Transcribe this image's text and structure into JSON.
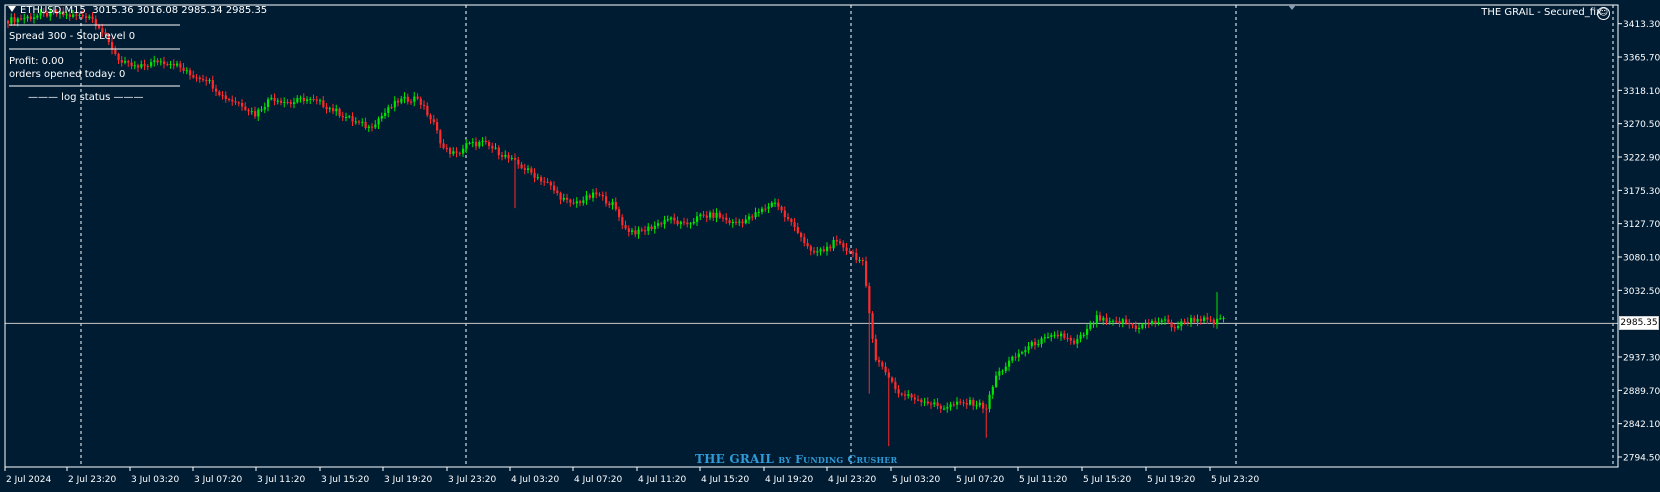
{
  "header": {
    "symbol": "ETHUSD,M15",
    "ohlc": "3015.36 3016.08 2985.34 2985.35"
  },
  "ea_panel": {
    "title": "THE GRAIL - Secured_fix",
    "spread_line": "Spread 300 - StopLevel 0",
    "profit_line": "Profit: 0.00",
    "orders_line": "orders opened today: 0",
    "log_line": "——— log status ———"
  },
  "watermark": {
    "main": "THE GRAIL",
    "by": "by Funding Crusher"
  },
  "colors": {
    "background": "#001c33",
    "bull": "#00e600",
    "bear": "#ff2a2a",
    "grid": "#ffffff",
    "text": "#ffffff",
    "watermark": "#2e9ad6"
  },
  "chart_data": {
    "type": "candlestick",
    "symbol": "ETHUSD",
    "timeframe": "M15",
    "current_price": "2985.35",
    "ylim": [
      2794.5,
      3440
    ],
    "y_ticks": [
      "3413.30",
      "3365.70",
      "3318.10",
      "3270.50",
      "3222.90",
      "3175.30",
      "3127.70",
      "3080.10",
      "3032.50",
      "2985.35",
      "2937.30",
      "2889.70",
      "2842.10",
      "2794.50"
    ],
    "x_ticks": [
      "2 Jul 2024",
      "2 Jul 23:20",
      "3 Jul 03:20",
      "3 Jul 07:20",
      "3 Jul 11:20",
      "3 Jul 15:20",
      "3 Jul 19:20",
      "3 Jul 23:20",
      "4 Jul 03:20",
      "4 Jul 07:20",
      "4 Jul 11:20",
      "4 Jul 15:20",
      "4 Jul 19:20",
      "4 Jul 23:20",
      "5 Jul 03:20",
      "5 Jul 07:20",
      "5 Jul 11:20",
      "5 Jul 15:20",
      "5 Jul 19:20",
      "5 Jul 23:20"
    ],
    "day_separators": [
      "2 Jul 23:20",
      "3 Jul 23:20",
      "4 Jul 23:20",
      "5 Jul 23:20"
    ],
    "close_anchors": [
      [
        0,
        3418
      ],
      [
        14,
        3428
      ],
      [
        20,
        3424
      ],
      [
        25,
        3425
      ],
      [
        28,
        3410
      ],
      [
        31,
        3385
      ],
      [
        35,
        3357
      ],
      [
        40,
        3350
      ],
      [
        46,
        3360
      ],
      [
        51,
        3357
      ],
      [
        56,
        3340
      ],
      [
        61,
        3335
      ],
      [
        66,
        3310
      ],
      [
        72,
        3298
      ],
      [
        76,
        3284
      ],
      [
        81,
        3308
      ],
      [
        87,
        3300
      ],
      [
        91,
        3306
      ],
      [
        96,
        3300
      ],
      [
        101,
        3288
      ],
      [
        106,
        3275
      ],
      [
        111,
        3265
      ],
      [
        115,
        3282
      ],
      [
        120,
        3303
      ],
      [
        126,
        3308
      ],
      [
        128,
        3292
      ],
      [
        131,
        3270
      ],
      [
        134,
        3235
      ],
      [
        138,
        3226
      ],
      [
        141,
        3240
      ],
      [
        146,
        3243
      ],
      [
        151,
        3230
      ],
      [
        156,
        3215
      ],
      [
        161,
        3200
      ],
      [
        166,
        3185
      ],
      [
        169,
        3170
      ],
      [
        173,
        3155
      ],
      [
        177,
        3162
      ],
      [
        181,
        3170
      ],
      [
        186,
        3155
      ],
      [
        190,
        3120
      ],
      [
        194,
        3115
      ],
      [
        199,
        3125
      ],
      [
        203,
        3135
      ],
      [
        208,
        3125
      ],
      [
        213,
        3138
      ],
      [
        218,
        3140
      ],
      [
        223,
        3128
      ],
      [
        228,
        3135
      ],
      [
        233,
        3150
      ],
      [
        236,
        3160
      ],
      [
        239,
        3138
      ],
      [
        243,
        3118
      ],
      [
        247,
        3085
      ],
      [
        251,
        3090
      ],
      [
        254,
        3100
      ],
      [
        257,
        3095
      ],
      [
        260,
        3085
      ],
      [
        263,
        3070
      ],
      [
        265,
        3000
      ],
      [
        267,
        2935
      ],
      [
        271,
        2910
      ],
      [
        274,
        2885
      ],
      [
        278,
        2880
      ],
      [
        282,
        2875
      ],
      [
        287,
        2865
      ],
      [
        292,
        2870
      ],
      [
        297,
        2872
      ],
      [
        301,
        2865
      ],
      [
        304,
        2910
      ],
      [
        308,
        2930
      ],
      [
        312,
        2945
      ],
      [
        316,
        2958
      ],
      [
        320,
        2963
      ],
      [
        324,
        2970
      ],
      [
        328,
        2955
      ],
      [
        332,
        2975
      ],
      [
        335,
        2993
      ],
      [
        339,
        2985
      ],
      [
        343,
        2988
      ],
      [
        347,
        2980
      ],
      [
        351,
        2985
      ],
      [
        355,
        2990
      ],
      [
        359,
        2980
      ],
      [
        363,
        2990
      ],
      [
        367,
        2992
      ],
      [
        371,
        2985
      ],
      [
        374,
        2995
      ]
    ]
  }
}
